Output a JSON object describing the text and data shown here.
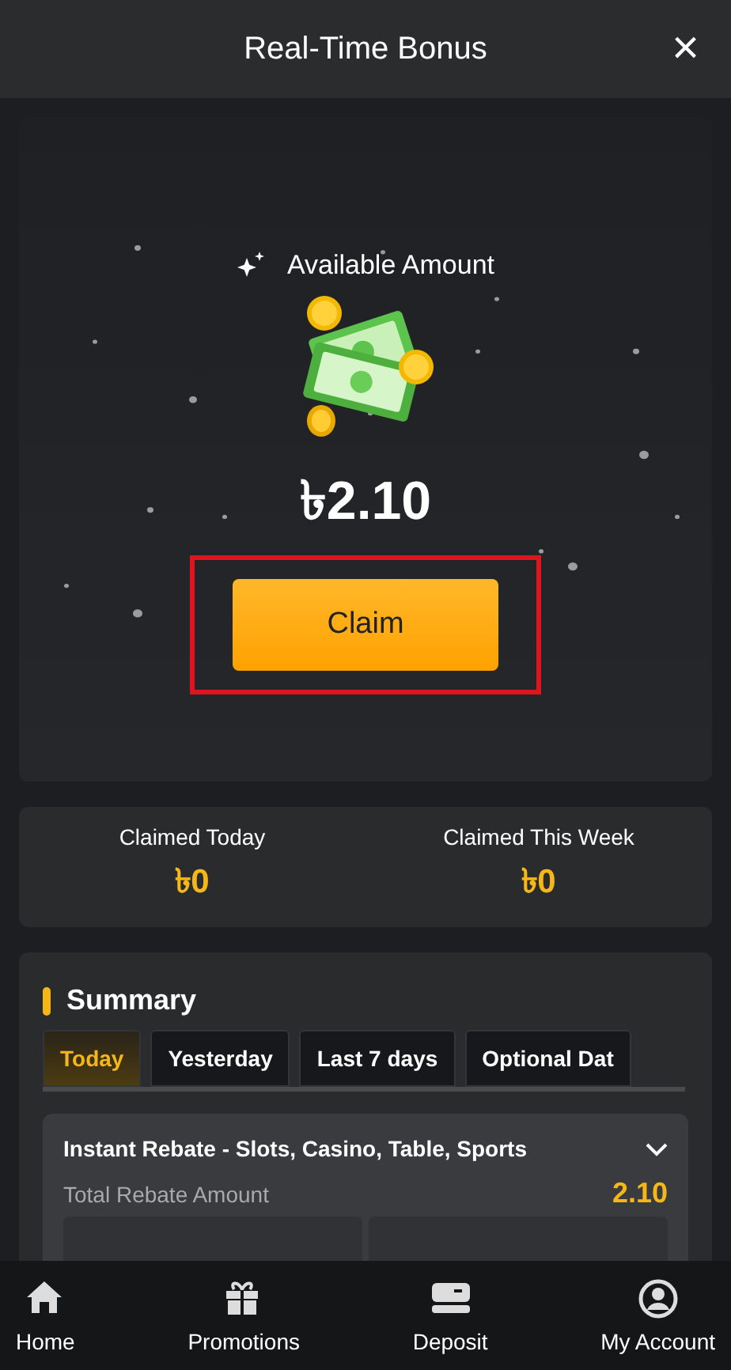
{
  "header": {
    "title": "Real-Time Bonus",
    "close": "×"
  },
  "bonus": {
    "label": "Available Amount",
    "amount": "৳2.10",
    "claim": "Claim",
    "highlighted": true
  },
  "stats": [
    {
      "label": "Claimed Today",
      "value": "৳0"
    },
    {
      "label": "Claimed This Week",
      "value": "৳0"
    }
  ],
  "summary": {
    "title": "Summary",
    "tabs": [
      {
        "label": "Today",
        "selected": true
      },
      {
        "label": "Yesterday",
        "selected": false
      },
      {
        "label": "Last 7 days",
        "selected": false
      },
      {
        "label": "Optional Dat",
        "selected": false
      }
    ],
    "rebate": {
      "title": "Instant Rebate - Slots, Casino, Table, Sports",
      "expanded": true,
      "total_label": "Total Rebate Amount",
      "total_value": "2.10"
    }
  },
  "nav": [
    {
      "kind": "home",
      "label": "Home"
    },
    {
      "kind": "gift",
      "label": "Promotions"
    },
    {
      "kind": "card",
      "label": "Deposit"
    },
    {
      "kind": "account",
      "label": "My Account"
    }
  ]
}
